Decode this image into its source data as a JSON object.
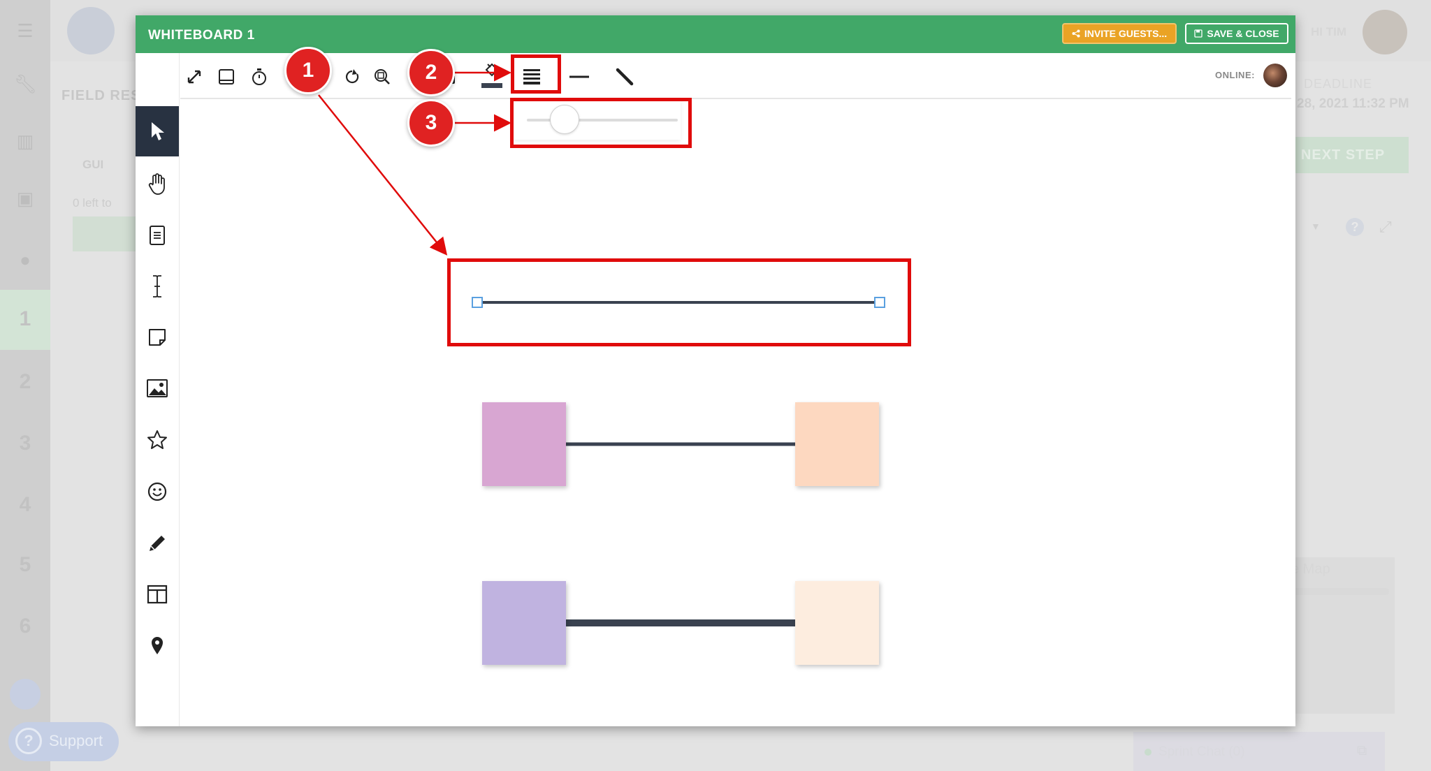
{
  "background": {
    "rail_steps": [
      "1",
      "2",
      "3",
      "4",
      "5",
      "6"
    ],
    "field_title": "FIELD RES",
    "guide_tab": "GUI",
    "left_text": "0 left to",
    "greeting": "HI TIM",
    "deadline_label": "DEADLINE",
    "deadline_date": "28, 2021 11:32 PM",
    "next_step": "NEXT STEP",
    "map_label": "e Map",
    "chat_label": "Sprint Chat (0)",
    "support_label": "Support"
  },
  "modal": {
    "title": "WHITEBOARD 1",
    "invite_label": "INVITE GUESTS...",
    "save_label": "SAVE & CLOSE",
    "online_label": "ONLINE:"
  },
  "toolbar": {
    "icons": [
      "expand-icon",
      "tablet-icon",
      "timer-icon",
      "undo-icon",
      "redo-icon",
      "zoom-fit-icon",
      "lock-icon",
      "fill-color-icon",
      "line-width-icon",
      "line-style-icon",
      "pen-line-icon"
    ]
  },
  "sidebar": {
    "tools": [
      "select-tool",
      "hand-tool",
      "document-tool",
      "text-tool",
      "sticky-note-tool",
      "image-tool",
      "star-tool",
      "emoji-tool",
      "pencil-tool",
      "template-tool",
      "location-pin-tool"
    ],
    "active": "select-tool"
  },
  "slider": {
    "value_fraction": 0.25
  },
  "canvas": {
    "sticky_colors": [
      "#d8a6d2",
      "#fdd8c0",
      "#c0b3e0",
      "#fdeddf"
    ],
    "line_color": "#3a4250"
  },
  "annotations": {
    "callouts": [
      "1",
      "2",
      "3"
    ],
    "highlight_color": "#e00b0b"
  }
}
